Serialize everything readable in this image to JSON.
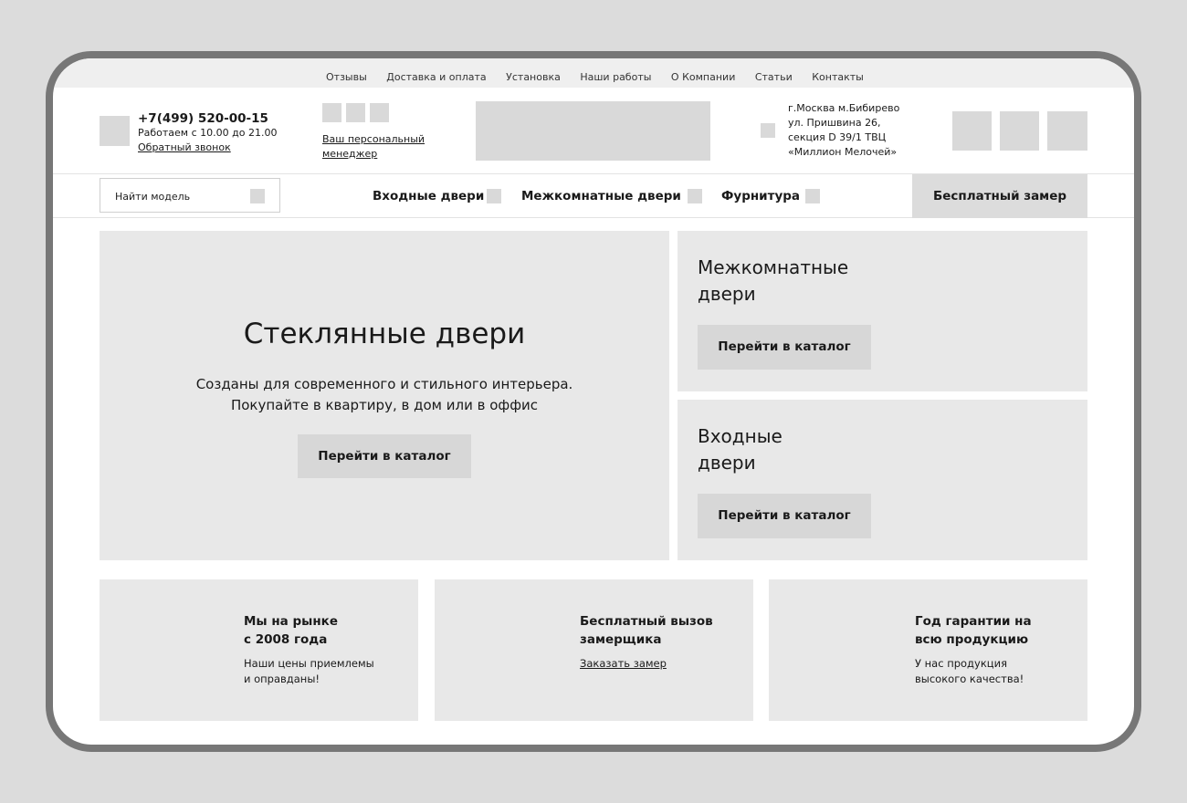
{
  "top_nav": [
    "Отзывы",
    "Доставка и оплата",
    "Установка",
    "Наши работы",
    "О Компании",
    "Статьи",
    "Контакты"
  ],
  "header": {
    "phone": "+7(499) 520-00-15",
    "hours": "Работаем с 10.00 до 21.00",
    "callback": "Обратный звонок",
    "manager_line1": "Ваш персональный",
    "manager_line2": "менеджер",
    "address": [
      "г.Москва м.Бибирево",
      "ул. Пришвина 26,",
      "секция D 39/1 ТВЦ",
      "«Миллион Мелочей»"
    ]
  },
  "menu": {
    "search_placeholder": "Найти модель",
    "items": [
      "Входные двери",
      "Межкомнатные двери",
      "Фурнитура"
    ],
    "cta": "Бесплатный замер"
  },
  "hero": {
    "title": "Стеклянные двери",
    "sub_line1": "Созданы для современного и стильного интерьера.",
    "sub_line2": "Покупайте в квартиру, в дом или в оффис",
    "button": "Перейти в каталог"
  },
  "side_cards": [
    {
      "line1": "Межкомнатные",
      "line2": "двери",
      "button": "Перейти в каталог"
    },
    {
      "line1": "Входные",
      "line2": "двери",
      "button": "Перейти в каталог"
    }
  ],
  "features": [
    {
      "title1": "Мы на рынке",
      "title2": "с 2008 года",
      "text1": "Наши цены приемлемы",
      "text2": "и оправданы!"
    },
    {
      "title1": "Бесплатный вызов",
      "title2": "замерщика",
      "link": "Заказать замер"
    },
    {
      "title1": "Год гарантии на",
      "title2": "всю продукцию",
      "text1": "У нас продукция",
      "text2": "высокого качества!"
    }
  ]
}
